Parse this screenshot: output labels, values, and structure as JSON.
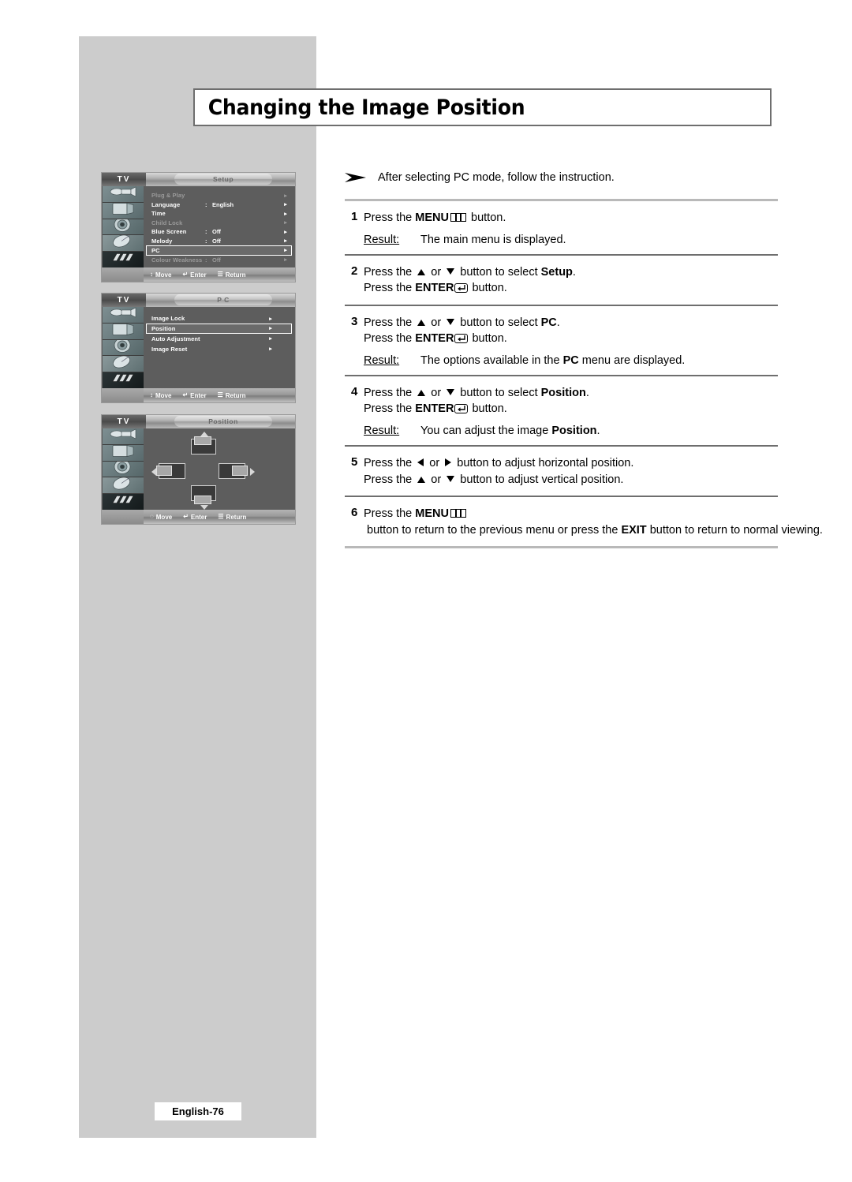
{
  "page": {
    "title": "Changing the Image Position",
    "footer_label": "English-76"
  },
  "note": {
    "marker": "arrow-marker",
    "text": "After selecting PC mode, follow the instruction."
  },
  "osd": {
    "setup": {
      "tv_label": "TV",
      "title": "Setup",
      "items": [
        {
          "label": "Plug & Play",
          "colon": "",
          "value": "",
          "arrow": "▸",
          "state": "dim"
        },
        {
          "label": "Language",
          "colon": ":",
          "value": "English",
          "arrow": "▸",
          "state": "normal"
        },
        {
          "label": "Time",
          "colon": "",
          "value": "",
          "arrow": "▸",
          "state": "normal"
        },
        {
          "label": "Child Lock",
          "colon": "",
          "value": "",
          "arrow": "▸",
          "state": "dim"
        },
        {
          "label": "Blue Screen",
          "colon": ":",
          "value": "Off",
          "arrow": "▸",
          "state": "normal"
        },
        {
          "label": "Melody",
          "colon": ":",
          "value": "Off",
          "arrow": "▸",
          "state": "normal"
        },
        {
          "label": "PC",
          "colon": "",
          "value": "",
          "arrow": "▸",
          "state": "selected"
        },
        {
          "label": "Colour Weakness",
          "colon": ":",
          "value": "Off",
          "arrow": "▸",
          "state": "dim"
        }
      ],
      "footer": [
        {
          "icon": "↕",
          "label": "Move"
        },
        {
          "icon": "↵",
          "label": "Enter"
        },
        {
          "icon": "☰",
          "label": "Return"
        }
      ]
    },
    "pc": {
      "tv_label": "TV",
      "title": "P C",
      "items": [
        {
          "label": "Image Lock",
          "colon": "",
          "value": "",
          "arrow": "▸",
          "state": "normal"
        },
        {
          "label": "Position",
          "colon": "",
          "value": "",
          "arrow": "▸",
          "state": "selected"
        },
        {
          "label": "Auto Adjustment",
          "colon": "",
          "value": "",
          "arrow": "▸",
          "state": "normal"
        },
        {
          "label": "Image Reset",
          "colon": "",
          "value": "",
          "arrow": "▸",
          "state": "normal"
        }
      ],
      "footer": [
        {
          "icon": "↕",
          "label": "Move"
        },
        {
          "icon": "↵",
          "label": "Enter"
        },
        {
          "icon": "☰",
          "label": "Return"
        }
      ]
    },
    "position": {
      "tv_label": "TV",
      "title": "Position",
      "graphic": "four-direction-position-adjust",
      "footer": [
        {
          "icon": "◌",
          "label": "Move"
        },
        {
          "icon": "↵",
          "label": "Enter"
        },
        {
          "icon": "☰",
          "label": "Return"
        }
      ]
    }
  },
  "steps": [
    {
      "num": "1",
      "lines": [
        {
          "parts": [
            {
              "t": "Press the ",
              "b": false
            },
            {
              "t": "MENU",
              "b": true
            },
            {
              "icon": "menu-icon"
            },
            {
              "t": " button.",
              "b": false
            }
          ]
        }
      ],
      "result": {
        "label": "Result:",
        "parts": [
          {
            "t": "The main menu is displayed.",
            "b": false
          }
        ]
      }
    },
    {
      "num": "2",
      "lines": [
        {
          "parts": [
            {
              "t": "Press the ",
              "b": false
            },
            {
              "icon": "triangle-up-icon"
            },
            {
              "t": " or ",
              "b": false
            },
            {
              "icon": "triangle-down-icon"
            },
            {
              "t": " button to select ",
              "b": false
            },
            {
              "t": "Setup",
              "b": true
            },
            {
              "t": ".",
              "b": false
            }
          ]
        },
        {
          "parts": [
            {
              "t": "Press the ",
              "b": false
            },
            {
              "t": "ENTER",
              "b": true
            },
            {
              "icon": "enter-icon"
            },
            {
              "t": " button.",
              "b": false
            }
          ]
        }
      ],
      "result": null
    },
    {
      "num": "3",
      "lines": [
        {
          "parts": [
            {
              "t": "Press the ",
              "b": false
            },
            {
              "icon": "triangle-up-icon"
            },
            {
              "t": " or ",
              "b": false
            },
            {
              "icon": "triangle-down-icon"
            },
            {
              "t": " button to select ",
              "b": false
            },
            {
              "t": "PC",
              "b": true
            },
            {
              "t": ".",
              "b": false
            }
          ]
        },
        {
          "parts": [
            {
              "t": "Press the ",
              "b": false
            },
            {
              "t": "ENTER",
              "b": true
            },
            {
              "icon": "enter-icon"
            },
            {
              "t": " button.",
              "b": false
            }
          ]
        }
      ],
      "result": {
        "label": "Result:",
        "parts": [
          {
            "t": "The options available in the ",
            "b": false
          },
          {
            "t": "PC",
            "b": true
          },
          {
            "t": " menu are displayed.",
            "b": false
          }
        ]
      }
    },
    {
      "num": "4",
      "lines": [
        {
          "parts": [
            {
              "t": "Press the ",
              "b": false
            },
            {
              "icon": "triangle-up-icon"
            },
            {
              "t": " or ",
              "b": false
            },
            {
              "icon": "triangle-down-icon"
            },
            {
              "t": " button to select ",
              "b": false
            },
            {
              "t": "Position",
              "b": true
            },
            {
              "t": ".",
              "b": false
            }
          ]
        },
        {
          "parts": [
            {
              "t": "Press the ",
              "b": false
            },
            {
              "t": "ENTER",
              "b": true
            },
            {
              "icon": "enter-icon"
            },
            {
              "t": " button.",
              "b": false
            }
          ]
        }
      ],
      "result": {
        "label": "Result:",
        "parts": [
          {
            "t": "You can adjust the image ",
            "b": false
          },
          {
            "t": "Position",
            "b": true
          },
          {
            "t": ".",
            "b": false
          }
        ]
      }
    },
    {
      "num": "5",
      "lines": [
        {
          "parts": [
            {
              "t": "Press the ",
              "b": false
            },
            {
              "icon": "triangle-left-icon"
            },
            {
              "t": " or ",
              "b": false
            },
            {
              "icon": "triangle-right-icon"
            },
            {
              "t": " button to adjust horizontal position.",
              "b": false
            }
          ]
        },
        {
          "parts": [
            {
              "t": "Press the ",
              "b": false
            },
            {
              "icon": "triangle-up-icon"
            },
            {
              "t": " or ",
              "b": false
            },
            {
              "icon": "triangle-down-icon"
            },
            {
              "t": " button to adjust vertical position.",
              "b": false
            }
          ]
        }
      ],
      "result": null
    },
    {
      "num": "6",
      "lines": [
        {
          "wrap": true,
          "parts": [
            {
              "t": "Press the ",
              "b": false
            },
            {
              "t": "MENU",
              "b": true
            },
            {
              "icon": "menu-icon"
            },
            {
              "t": " button to return to the previous menu or press the ",
              "b": false
            },
            {
              "t": "EXIT",
              "b": true
            },
            {
              "t": " button to return to normal viewing.",
              "b": false
            }
          ]
        }
      ],
      "result": null
    }
  ],
  "colors": {
    "band_gray": "#cccccc",
    "osd_body": "#5d5d5d",
    "rule_gray": "#b9b9b9",
    "rule_dark": "#6e6e6e"
  }
}
